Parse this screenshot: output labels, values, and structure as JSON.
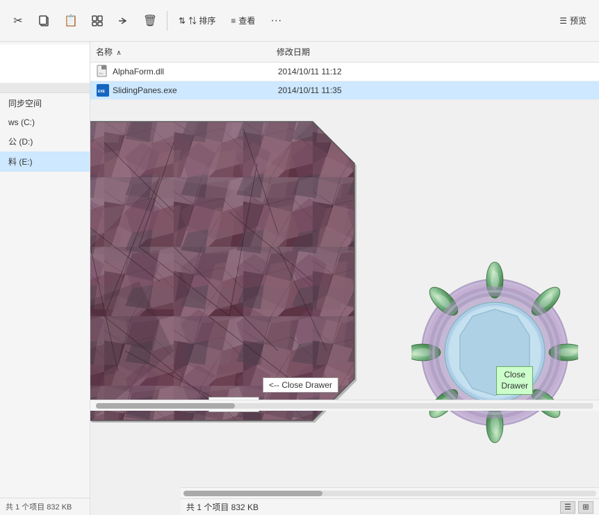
{
  "toolbar": {
    "buttons": [
      {
        "id": "cut",
        "label": "✂",
        "title": "切剪"
      },
      {
        "id": "copy",
        "label": "⧉",
        "title": "复制"
      },
      {
        "id": "paste",
        "label": "📋",
        "title": "粘贴"
      },
      {
        "id": "move",
        "label": "⤢",
        "title": "移动"
      },
      {
        "id": "share",
        "label": "↗",
        "title": "共享"
      },
      {
        "id": "delete",
        "label": "🗑",
        "title": "删除"
      },
      {
        "id": "sort",
        "label": "⇅ 排序"
      },
      {
        "id": "view",
        "label": "≡ 查看"
      },
      {
        "id": "more",
        "label": "..."
      }
    ],
    "preview_label": "预览"
  },
  "file_list": {
    "col_name": "名称",
    "col_sort_arrow": "∧",
    "col_date": "修改日期",
    "files": [
      {
        "name": "AlphaForm.dll",
        "date": "2014/10/11 11:12",
        "type": "dll",
        "selected": false
      },
      {
        "name": "SlidingPanes.exe",
        "date": "2014/10/11 11:35",
        "type": "exe",
        "selected": true
      }
    ]
  },
  "buttons": {
    "close_drawer_left": "<-- Close Drawer",
    "close_drawer_right_line1": "Close",
    "close_drawer_right_line2": "Drawer",
    "close": "Close"
  },
  "sidebar": {
    "items": [
      {
        "label": "同步空间"
      },
      {
        "label": "ws (C:)"
      },
      {
        "label": "公 (D:)"
      },
      {
        "label": "料 (E:)"
      }
    ],
    "selected_index": 3
  },
  "status_bar": {
    "text": "共 1 个项目  832 KB"
  },
  "preview": {
    "label": "预览"
  },
  "colors": {
    "accent": "#0078d7",
    "selected_bg": "#cde8ff",
    "close_drawer_bg": "#ccffcc"
  }
}
